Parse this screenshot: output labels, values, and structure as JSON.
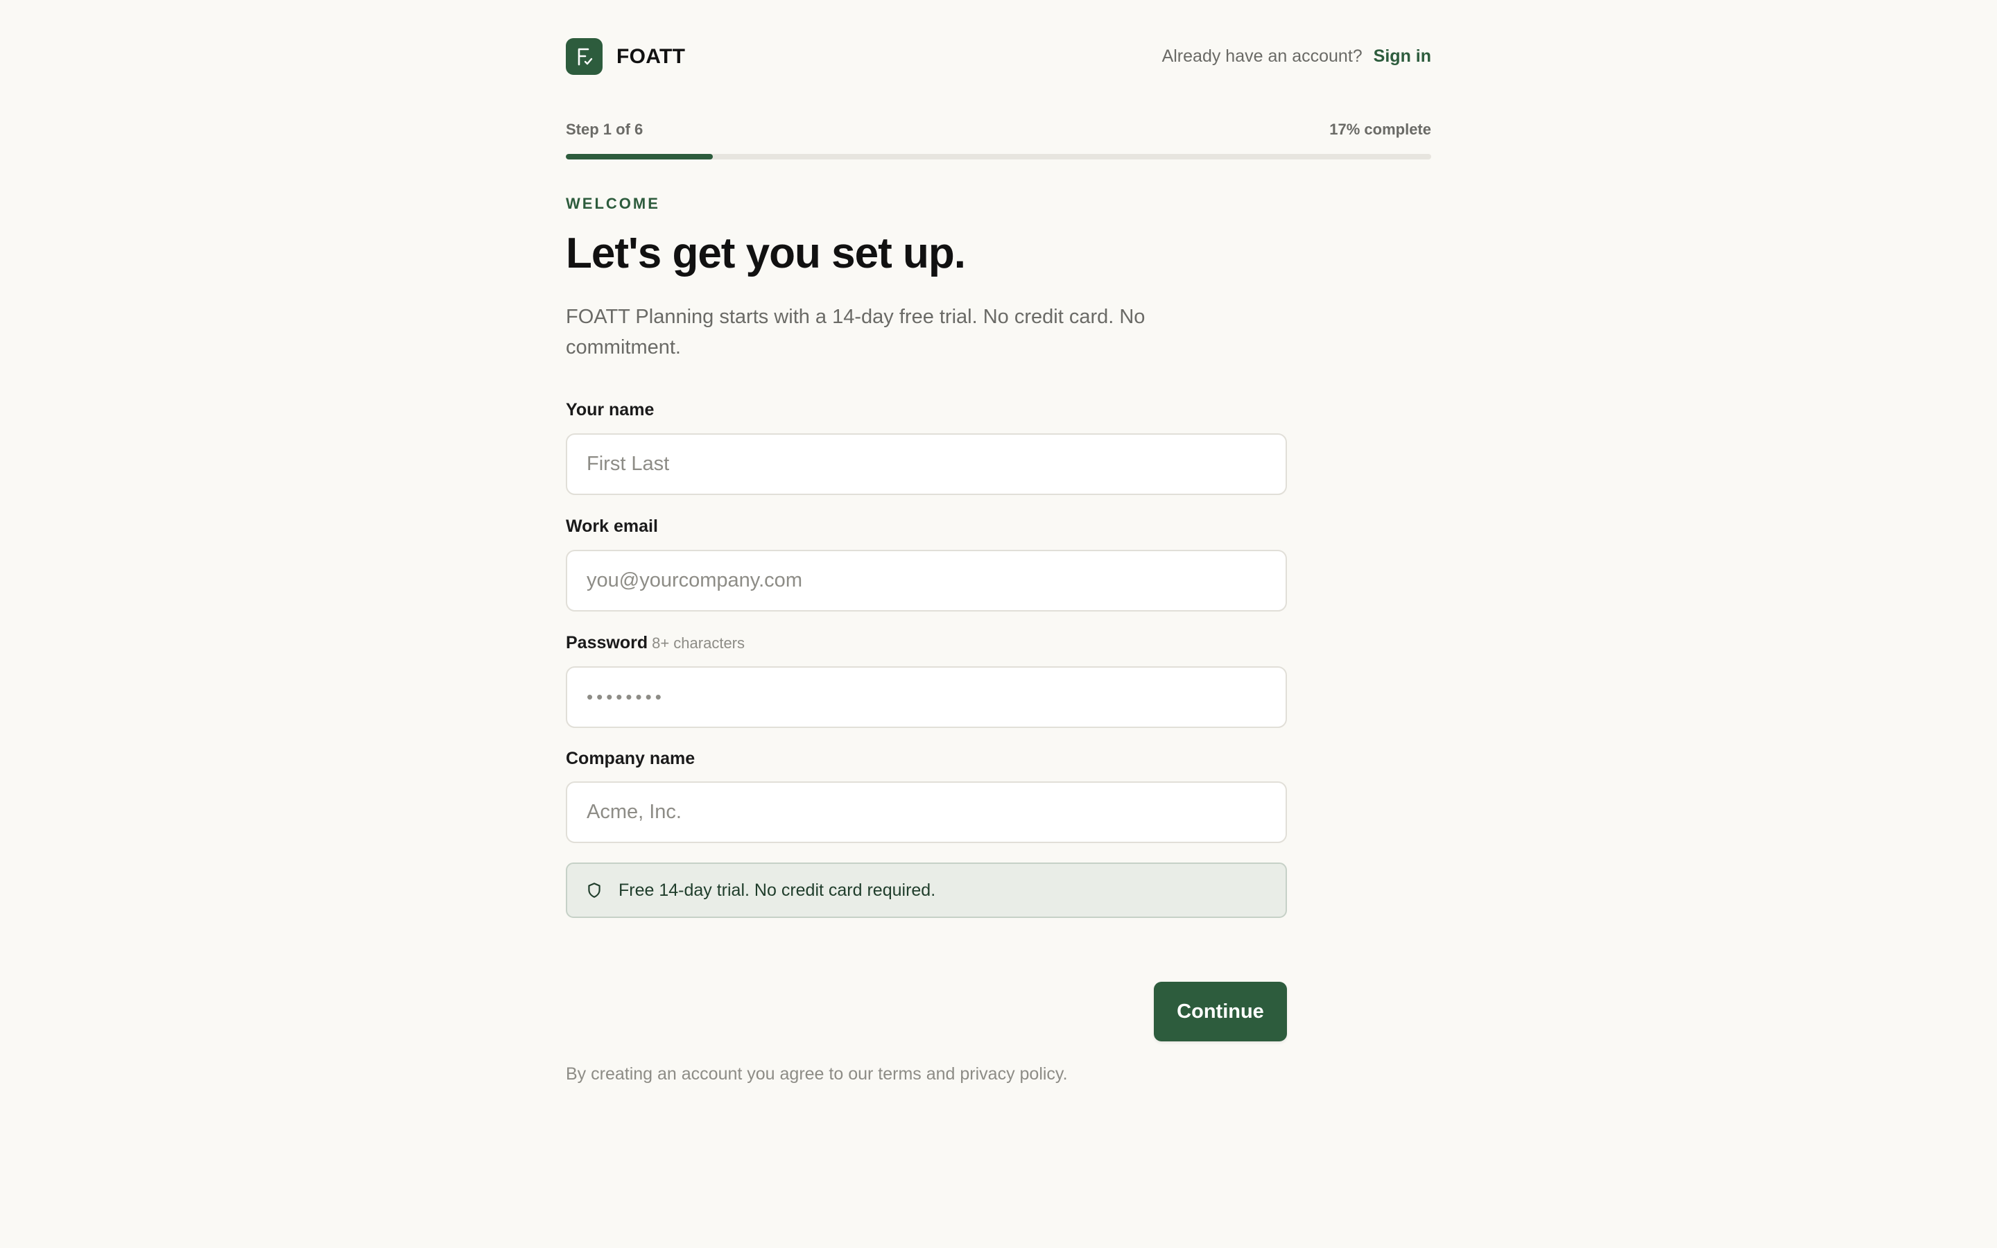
{
  "brand": {
    "name": "FOATT",
    "logo_icon": "foatt-logo-icon",
    "accent": "#2d5c3d"
  },
  "header": {
    "signin_prompt": "Already have an account?",
    "signin_link": "Sign in"
  },
  "progress": {
    "step_label": "Step 1 of 6",
    "complete_label": "17% complete",
    "fraction": 0.17
  },
  "intro": {
    "eyebrow": "WELCOME",
    "title": "Let's get you set up.",
    "subtitle": "FOATT Planning starts with a 14-day free trial. No credit card. No commitment."
  },
  "form": {
    "name": {
      "label": "Your name",
      "placeholder": "First Last",
      "value": ""
    },
    "email": {
      "label": "Work email",
      "placeholder": "you@yourcompany.com",
      "value": ""
    },
    "password": {
      "label": "Password",
      "hint": "8+ characters",
      "placeholder": "••••••••",
      "value": ""
    },
    "company": {
      "label": "Company name",
      "placeholder": "Acme, Inc.",
      "value": ""
    }
  },
  "notice": {
    "icon": "shield-icon",
    "text": "Free 14-day trial. No credit card required."
  },
  "actions": {
    "continue_label": "Continue"
  },
  "footer": {
    "legal": "By creating an account you agree to our terms and privacy policy."
  }
}
